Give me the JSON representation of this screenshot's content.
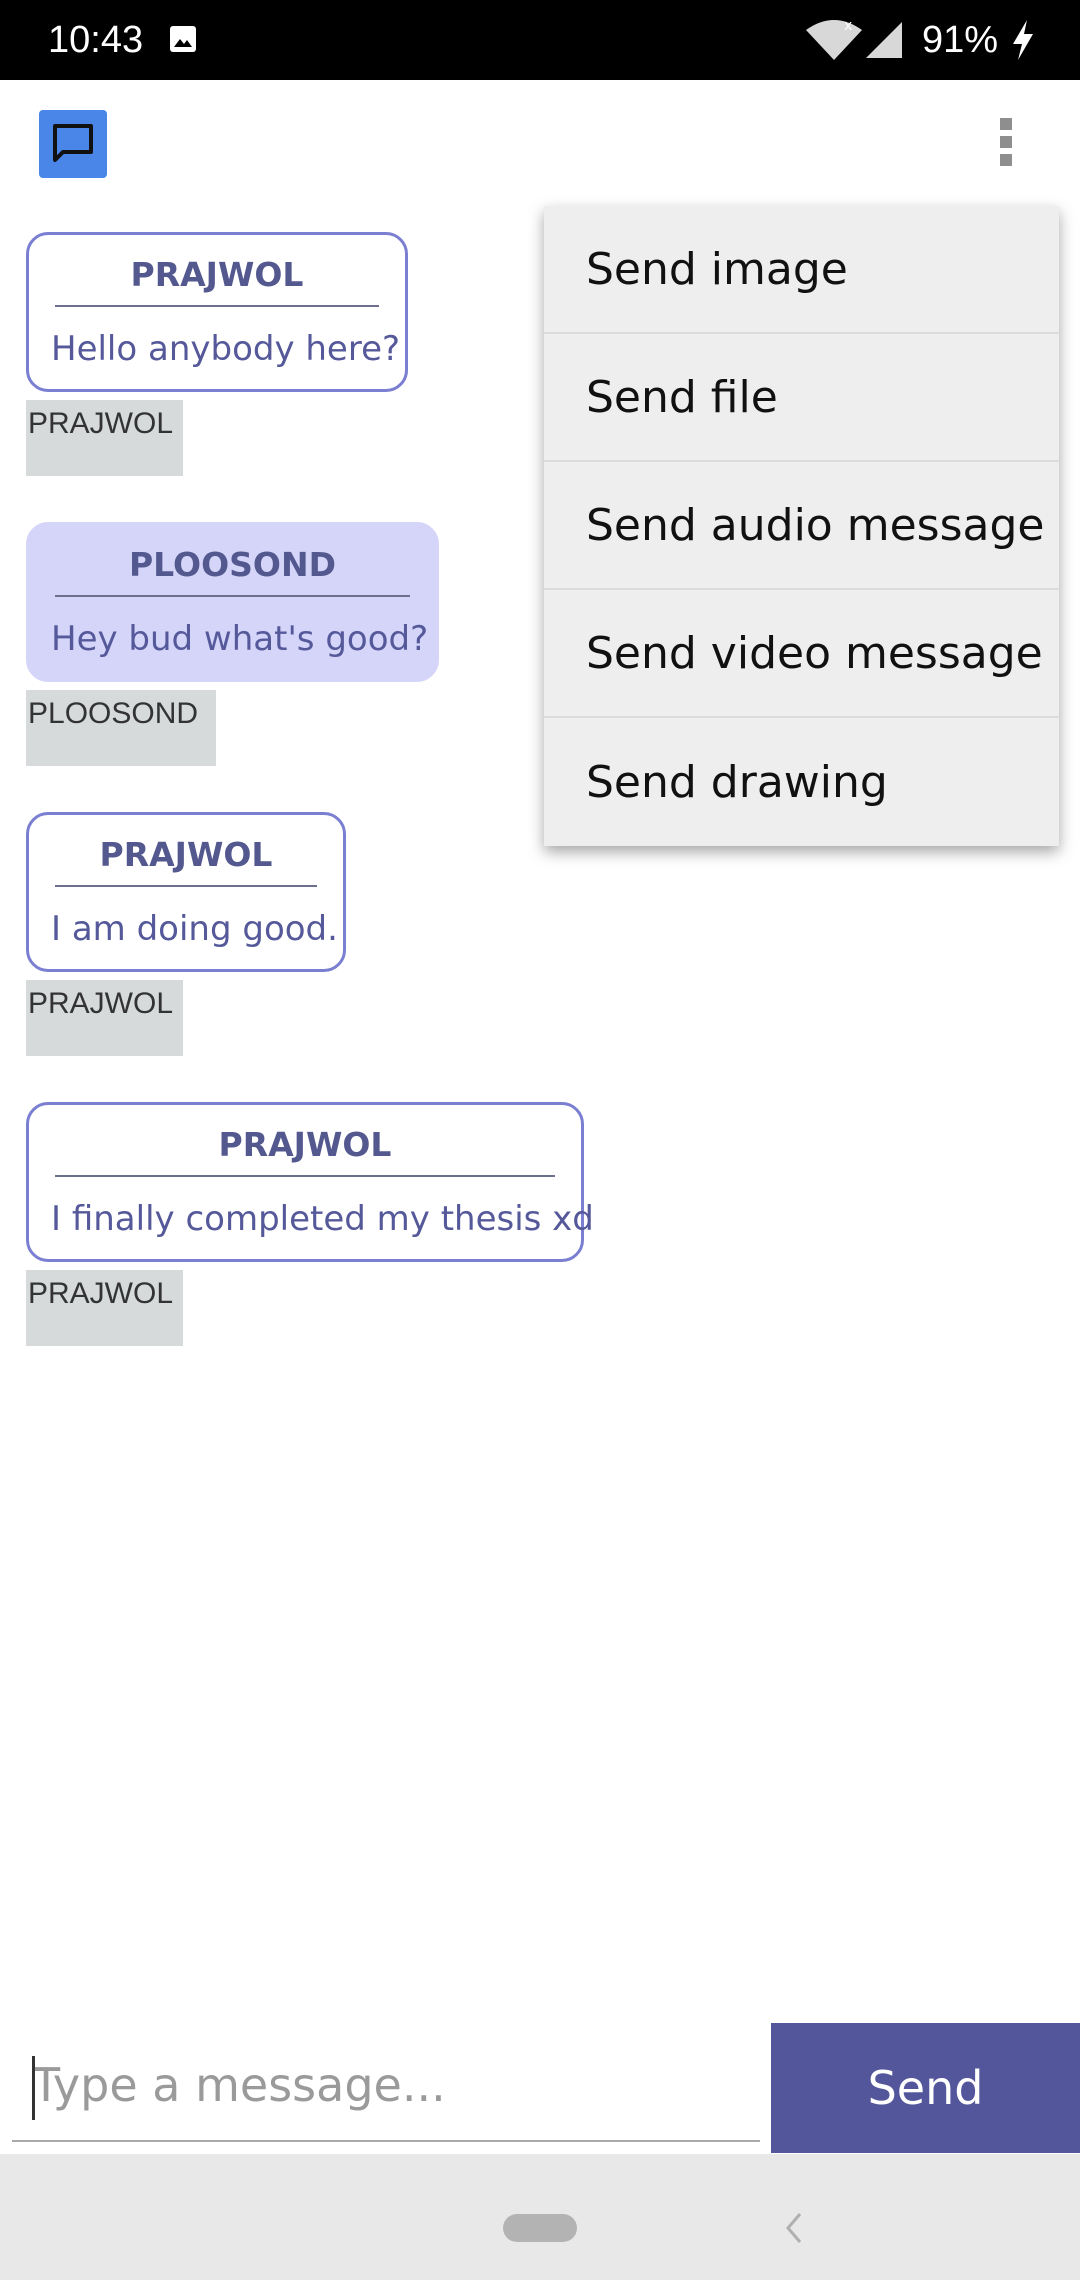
{
  "status_bar": {
    "time": "10:43",
    "battery": "91%",
    "icons": [
      "image-icon",
      "wifi-icon",
      "signal-icon",
      "charging-icon"
    ]
  },
  "app_bar": {
    "icons": [
      "chat-icon",
      "overflow-menu-icon"
    ],
    "accent_color": "#4a86e8"
  },
  "messages": [
    {
      "sender": "PRAJWOL",
      "text": "Hello anybody here?",
      "name_tag": "PRAJWOL",
      "style": "outgoing"
    },
    {
      "sender": "PLOOSOND",
      "text": "Hey bud what's good?",
      "name_tag": "PLOOSOND",
      "style": "incoming"
    },
    {
      "sender": "PRAJWOL",
      "text": "I am doing good.",
      "name_tag": "PRAJWOL",
      "style": "outgoing"
    },
    {
      "sender": "PRAJWOL",
      "text": "I finally completed my thesis xd",
      "name_tag": "PRAJWOL",
      "style": "outgoing"
    }
  ],
  "menu": {
    "items": [
      "Send image",
      "Send file",
      "Send audio message",
      "Send video message",
      "Send drawing"
    ]
  },
  "composer": {
    "placeholder": "Type a message...",
    "value": "",
    "send_label": "Send",
    "send_color": "#53569b"
  },
  "nav_bar": {
    "icons": [
      "home-pill-icon",
      "back-icon"
    ]
  }
}
